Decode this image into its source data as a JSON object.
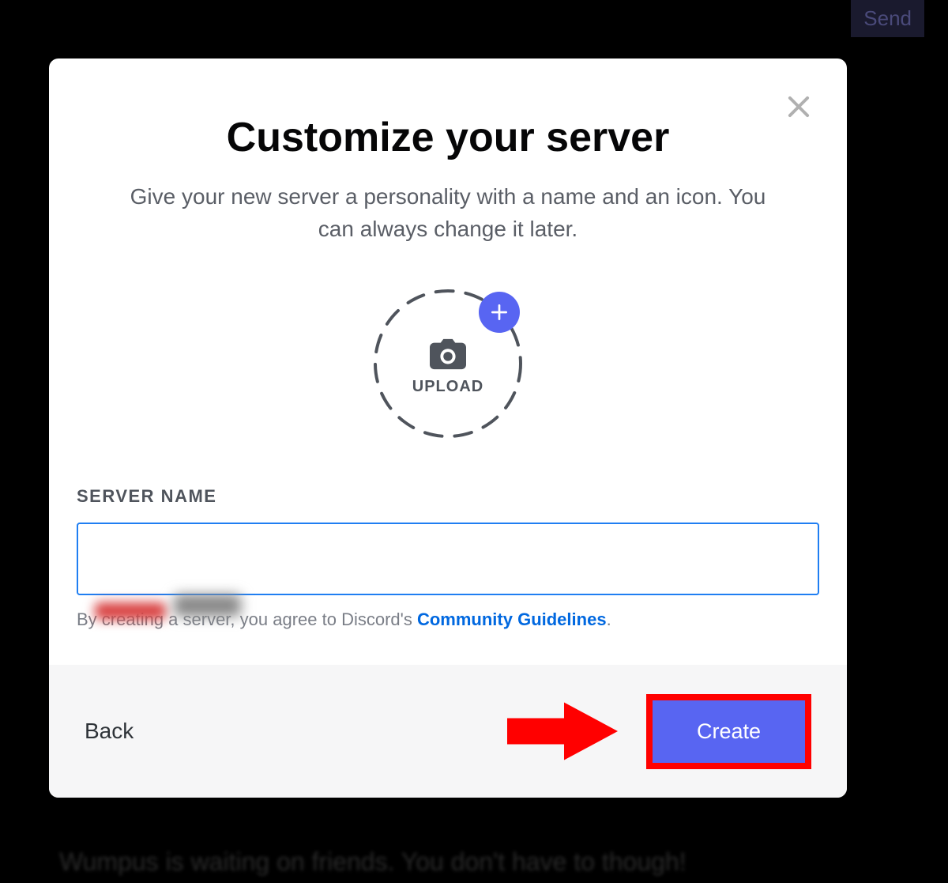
{
  "background": {
    "send_button": "Send",
    "bottom_text": "Wumpus is waiting on friends. You don't have to though!"
  },
  "modal": {
    "title": "Customize your server",
    "subtitle": "Give your new server a personality with a name and an icon. You can always change it later.",
    "upload": {
      "label": "UPLOAD"
    },
    "server_name": {
      "label": "SERVER NAME",
      "value": ""
    },
    "guidelines": {
      "prefix": "By creating a server, you agree to Discord's ",
      "link": "Community Guidelines",
      "suffix": "."
    },
    "footer": {
      "back": "Back",
      "create": "Create"
    }
  },
  "colors": {
    "accent": "#5865f2",
    "link": "#0068e0",
    "highlight": "#ff0000"
  }
}
